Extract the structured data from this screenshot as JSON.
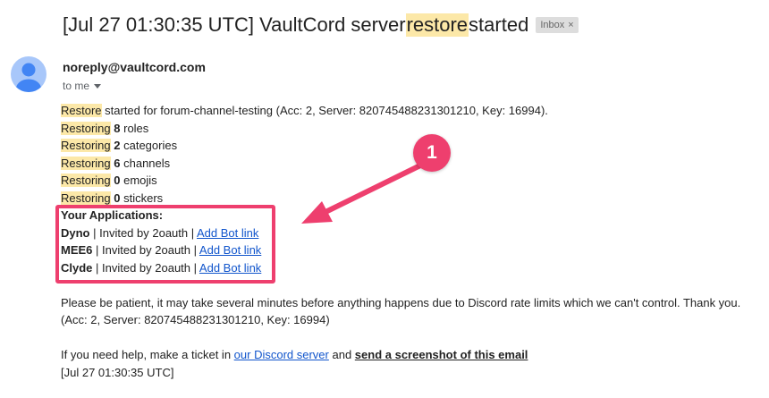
{
  "email": {
    "subject_pre": "[Jul 27 01:30:35 UTC] VaultCord server ",
    "subject_hl": "restore",
    "subject_post": " started",
    "label": "Inbox",
    "label_close": "×",
    "sender": "noreply@vaultcord.com",
    "to": "to me"
  },
  "body": {
    "restore_word": "Restore",
    "restore_rest": " started for forum-channel-testing (Acc: 2, Server: 820745488231301210, Key: 16994).",
    "restoring_word": "Restoring",
    "restoring_items": [
      {
        "count": "8",
        "label": " roles"
      },
      {
        "count": "2",
        "label": " categories"
      },
      {
        "count": "6",
        "label": " channels"
      },
      {
        "count": "0",
        "label": " emojis"
      },
      {
        "count": "0",
        "label": " stickers"
      }
    ],
    "apps_heading": "Your Applications:",
    "apps": [
      {
        "name": "Dyno",
        "invited": " | Invited by 2oauth | ",
        "link": "Add Bot link"
      },
      {
        "name": "MEE6",
        "invited": " | Invited by 2oauth | ",
        "link": "Add Bot link"
      },
      {
        "name": "Clyde",
        "invited": " | Invited by 2oauth | ",
        "link": "Add Bot link"
      }
    ],
    "patience": "Please be patient, it may take several minutes before anything happens due to Discord rate limits which we can't control. Thank you.",
    "ids": "(Acc: 2, Server: 820745488231301210, Key: 16994)",
    "help_pre": "If you need help, make a ticket in ",
    "help_link": "our Discord server",
    "help_mid": " and ",
    "help_bold": "send a screenshot of this email",
    "timestamp": "[Jul 27 01:30:35 UTC]"
  },
  "annotation": {
    "marker_number": "1",
    "color": "#ee3f6e"
  },
  "colors": {
    "highlight": "#fce8a8",
    "link": "#1155cc",
    "avatar_bg": "#a8c7fa",
    "avatar_fg": "#4285f4"
  },
  "icons": {
    "avatar": "person-icon",
    "dropdown": "caret-down-icon",
    "label_remove": "close-icon"
  }
}
